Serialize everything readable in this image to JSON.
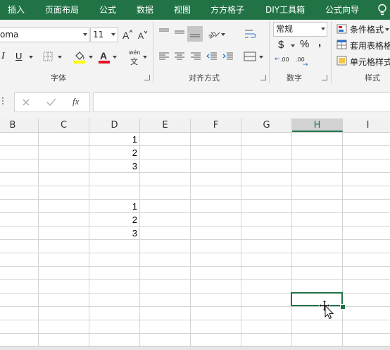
{
  "menu": {
    "tabs": [
      "插入",
      "页面布局",
      "公式",
      "数据",
      "视图",
      "方方格子",
      "DIY工具箱",
      "公式向导"
    ]
  },
  "ribbon": {
    "font_name": "oma",
    "font_size": "11",
    "number_format": "常规",
    "groups": {
      "font": "字体",
      "alignment": "对齐方式",
      "number": "数字",
      "styles": "样式"
    },
    "styles_buttons": [
      "条件格式",
      "套用表格格",
      "单元格样式"
    ],
    "phonetic_top": "wén",
    "phonetic_bottom": "文",
    "percent_symbol": "%",
    "currency_symbol": "$",
    "comma_symbol": ",",
    "dec_increase": ".00",
    "dec_decrease": ".00"
  },
  "formula_bar": {
    "fx_label": "fx",
    "value": ""
  },
  "sheet": {
    "columns": [
      "B",
      "C",
      "D",
      "E",
      "F",
      "G",
      "H",
      "I"
    ],
    "selected_column": "H",
    "cells": [
      {
        "col": "D",
        "value": "1"
      },
      {
        "col": "D",
        "value": "2"
      },
      {
        "col": "D",
        "value": "3"
      },
      {
        "col": "D",
        "value": "1"
      },
      {
        "col": "D",
        "value": "2"
      },
      {
        "col": "D",
        "value": "3"
      }
    ]
  },
  "colors": {
    "accent": "#217346",
    "font_color": "#e81123",
    "fill_color": "#ffff00"
  }
}
